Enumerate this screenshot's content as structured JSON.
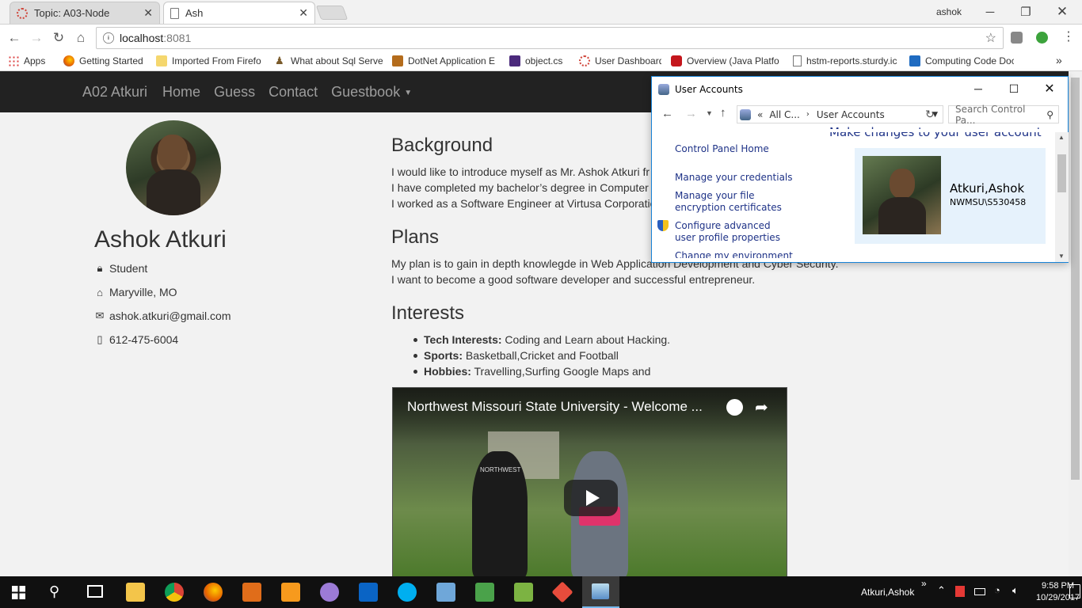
{
  "browser": {
    "tabs": [
      {
        "title": "Topic: A03-Node",
        "active": false
      },
      {
        "title": "Ash",
        "active": true
      }
    ],
    "profile_user": "ashok",
    "url_host": "localhost",
    "url_port": ":8081",
    "bookmarks": [
      {
        "label": "Apps",
        "icon": "apps-grid-icon"
      },
      {
        "label": "Getting Started",
        "icon": "firefox-icon"
      },
      {
        "label": "Imported From Firefo",
        "icon": "folder-icon"
      },
      {
        "label": "What about Sql Serve",
        "icon": "person-icon"
      },
      {
        "label": "DotNet Application E",
        "icon": "badge-icon"
      },
      {
        "label": "object.cs",
        "icon": "dotnet-icon"
      },
      {
        "label": "User Dashboard",
        "icon": "ring-icon"
      },
      {
        "label": "Overview (Java Platfo",
        "icon": "oracle-icon"
      },
      {
        "label": "hstm-reports.sturdy.ic",
        "icon": "page-icon"
      },
      {
        "label": "Computing Code Doc",
        "icon": "sharepoint-icon"
      }
    ],
    "bookmarks_overflow": "»"
  },
  "site": {
    "brand": "A02 Atkuri",
    "nav": [
      "Home",
      "Guess",
      "Contact",
      "Guestbook"
    ],
    "profile": {
      "name": "Ashok Atkuri",
      "role": "Student",
      "location": "Maryville, MO",
      "email": "ashok.atkuri@gmail.com",
      "phone": "612-475-6004"
    },
    "background": {
      "heading": "Background",
      "lines": [
        "I would like to introduce myself as Mr. Ashok Atkuri fr",
        "I have completed my bachelor’s degree in Computer",
        "I worked as a Software Engineer at Virtusa Corporatio"
      ]
    },
    "plans": {
      "heading": "Plans",
      "lines": [
        "My plan is to gain in depth knowlegde in Web Application Development and Cyber Security.",
        "I want to become a good software developer and successful entrepreneur."
      ]
    },
    "interests": {
      "heading": "Interests",
      "items": [
        {
          "label": "Tech Interests:",
          "value": " Coding and Learn about Hacking."
        },
        {
          "label": "Sports:",
          "value": " Basketball,Cricket and Football"
        },
        {
          "label": "Hobbies:",
          "value": " Travelling,Surfing Google Maps and"
        }
      ]
    },
    "video": {
      "title": "Northwest Missouri State University - Welcome ...",
      "shirt_text": "NORTHWEST"
    }
  },
  "dialog": {
    "title": "User Accounts",
    "breadcrumb": [
      "«",
      "All C...",
      "User Accounts"
    ],
    "search_placeholder": "Search Control Pa...",
    "heading": "Make changes to your user account",
    "links": [
      "Control Panel Home",
      "Manage your credentials",
      "Manage your file encryption certificates",
      "Configure advanced user profile properties",
      "Change my environment"
    ],
    "user_name": "Atkuri,Ashok",
    "user_account": "NWMSU\\S530458"
  },
  "taskbar": {
    "user": "Atkuri,Ashok",
    "overflow": "»",
    "time": "9:58 PM",
    "date": "10/29/2017",
    "apps": [
      "start-icon",
      "search-icon",
      "task-view-icon",
      "file-explorer-icon",
      "chrome-icon",
      "firefox-icon",
      "visual-studio-icon",
      "sublime-icon",
      "github-desktop-icon",
      "outlook-icon",
      "skype-icon",
      "virtualbox-icon",
      "sheets-icon",
      "project-icon",
      "git-icon",
      "control-panel-icon"
    ]
  },
  "colors": {
    "navbar": "#222222",
    "nav_text": "#9d9d9d",
    "dialog_accent": "#1883d7",
    "link": "#1e3287"
  }
}
